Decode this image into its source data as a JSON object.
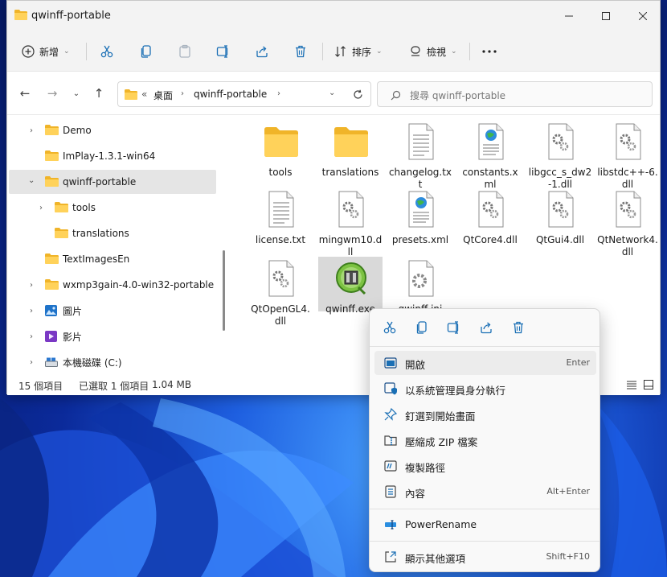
{
  "window": {
    "title": "qwinff-portable"
  },
  "toolbar": {
    "new_label": "新增",
    "sort_label": "排序",
    "view_label": "檢視"
  },
  "address": {
    "overflow": "«",
    "crumbs": [
      "桌面",
      "qwinff-portable"
    ],
    "search_placeholder": "搜尋 qwinff-portable"
  },
  "nav": {
    "items": [
      {
        "label": "Demo"
      },
      {
        "label": "ImPlay-1.3.1-win64"
      },
      {
        "label": "qwinff-portable"
      },
      {
        "label": "tools"
      },
      {
        "label": "translations"
      },
      {
        "label": "TextImagesEn"
      },
      {
        "label": "wxmp3gain-4.0-win32-portable"
      },
      {
        "label": "圖片"
      },
      {
        "label": "影片"
      },
      {
        "label": "本機磁碟 (C:)"
      }
    ]
  },
  "files": [
    {
      "name": "tools",
      "type": "folder"
    },
    {
      "name": "translations",
      "type": "folder"
    },
    {
      "name": "changelog.txt",
      "type": "text"
    },
    {
      "name": "constants.xml",
      "type": "xml"
    },
    {
      "name": "libgcc_s_dw2-1.dll",
      "type": "dll"
    },
    {
      "name": "libstdc++-6.dll",
      "type": "dll"
    },
    {
      "name": "license.txt",
      "type": "text"
    },
    {
      "name": "mingwm10.dll",
      "type": "dll"
    },
    {
      "name": "presets.xml",
      "type": "xml"
    },
    {
      "name": "QtCore4.dll",
      "type": "dll"
    },
    {
      "name": "QtGui4.dll",
      "type": "dll"
    },
    {
      "name": "QtNetwork4.dll",
      "type": "dll"
    },
    {
      "name": "QtOpenGL4.dll",
      "type": "dll"
    },
    {
      "name": "qwinff.exe",
      "type": "exe"
    },
    {
      "name": "qwinff.ini",
      "type": "ini"
    }
  ],
  "status": {
    "count": "15 個項目",
    "selected": "已選取 1 個項目",
    "size": "1.04 MB"
  },
  "context_menu": {
    "items": [
      {
        "label": "開啟",
        "shortcut": "Enter"
      },
      {
        "label": "以系統管理員身分執行",
        "shortcut": ""
      },
      {
        "label": "釘選到開始畫面",
        "shortcut": ""
      },
      {
        "label": "壓縮成 ZIP 檔案",
        "shortcut": ""
      },
      {
        "label": "複製路徑",
        "shortcut": ""
      },
      {
        "label": "內容",
        "shortcut": "Alt+Enter"
      },
      {
        "label": "PowerRename",
        "shortcut": ""
      },
      {
        "label": "顯示其他選項",
        "shortcut": "Shift+F10"
      }
    ]
  }
}
